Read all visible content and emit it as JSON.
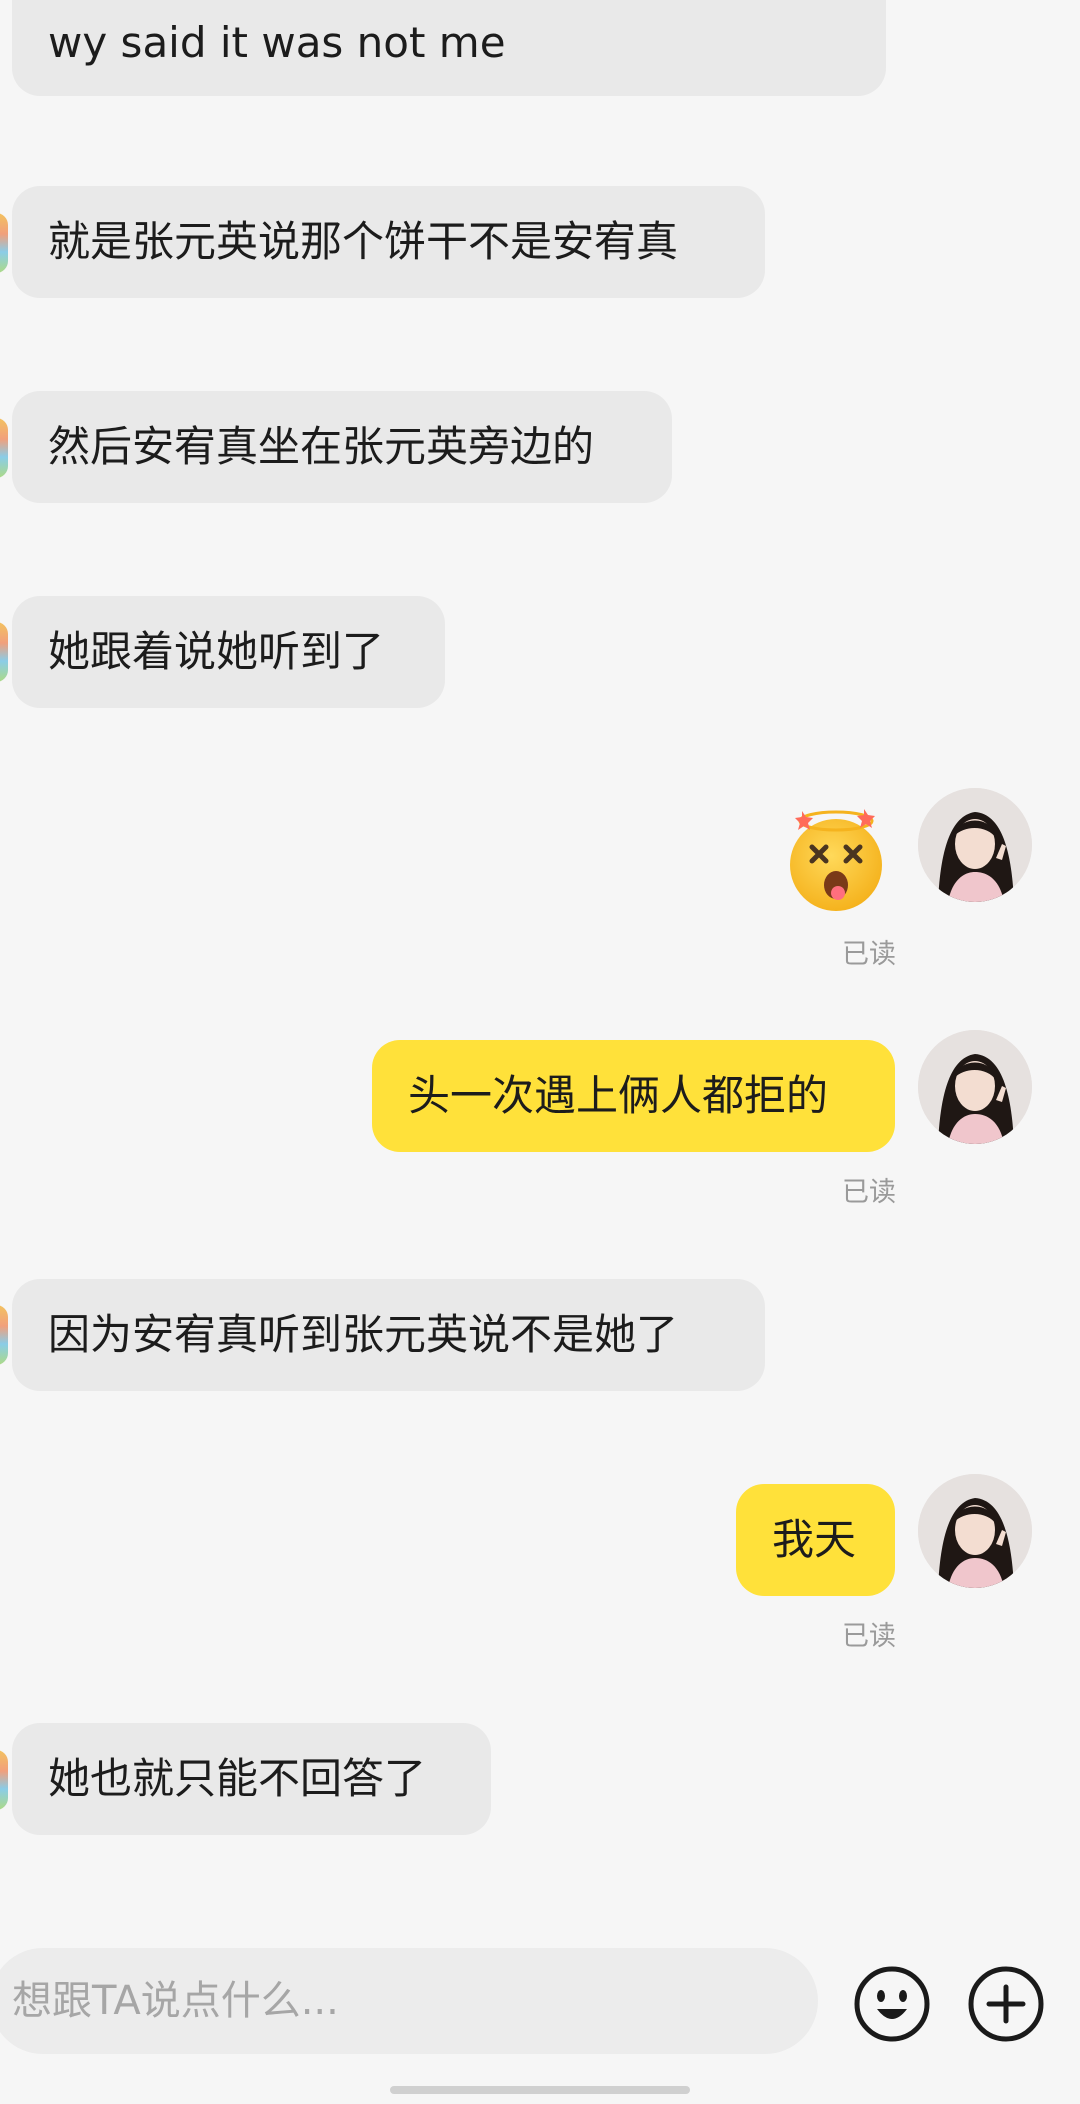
{
  "messages": [
    {
      "side": "in",
      "text": "wy said it was not me"
    },
    {
      "side": "in",
      "text": "就是张元英说那个饼干不是安宥真"
    },
    {
      "side": "in",
      "text": "然后安宥真坐在张元英旁边的"
    },
    {
      "side": "in",
      "text": "她跟着说她听到了"
    },
    {
      "side": "out",
      "sticker": "dizzy-face-emoji",
      "status": "已读"
    },
    {
      "side": "out",
      "text": "头一次遇上俩人都拒的",
      "status": "已读"
    },
    {
      "side": "in",
      "text": "因为安宥真听到张元英说不是她了"
    },
    {
      "side": "out",
      "text": "我天",
      "status": "已读"
    },
    {
      "side": "in",
      "text": "她也就只能不回答了"
    }
  ],
  "composer": {
    "placeholder": "想跟TA说点什么...",
    "emoji_button_icon": "smiley-face-icon",
    "add_button_icon": "plus-circle-icon"
  },
  "colors": {
    "background": "#f6f6f6",
    "incoming_bubble": "#e9e9e9",
    "outgoing_bubble": "#ffe13a",
    "read_status": "#9a9a9a"
  }
}
